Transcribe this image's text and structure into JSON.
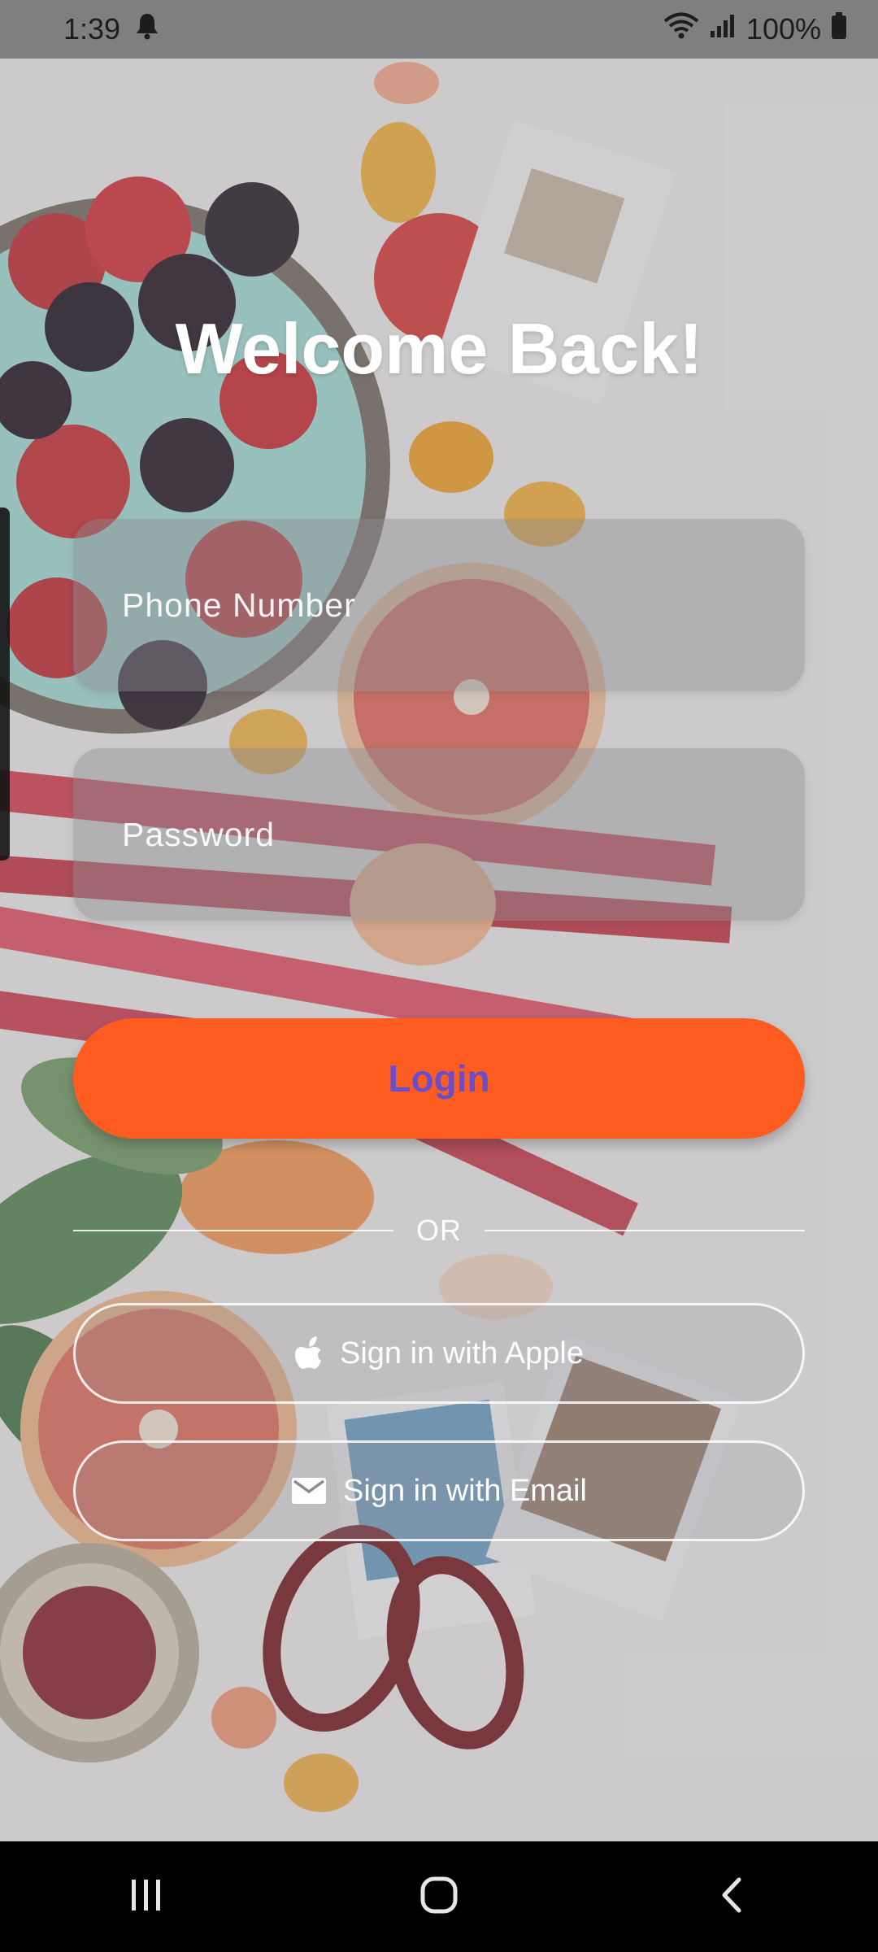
{
  "status_bar": {
    "time": "1:39",
    "battery": "100%",
    "icons": [
      "notification-icon",
      "wifi-icon",
      "signal-icon",
      "battery-icon"
    ]
  },
  "title": "Welcome Back!",
  "form": {
    "phone_placeholder": "Phone Number",
    "password_placeholder": "Password",
    "login_label": "Login"
  },
  "divider": {
    "label": "OR"
  },
  "social": {
    "apple_label": "Sign in with Apple",
    "email_label": "Sign in with Email"
  },
  "nav": {
    "icons": [
      "recents-icon",
      "home-icon",
      "back-icon"
    ]
  },
  "colors": {
    "accent": "#ff5c22",
    "login_text": "#6a4ec9"
  }
}
